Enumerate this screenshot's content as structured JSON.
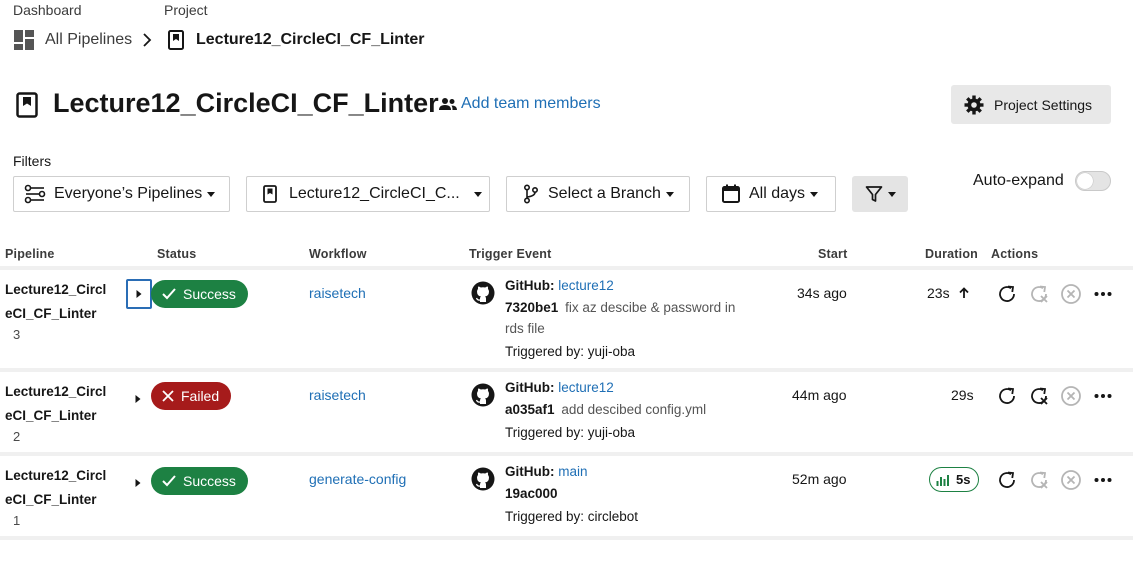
{
  "breadcrumb": {
    "dashboard_label": "Dashboard",
    "project_label": "Project",
    "all_pipelines": "All Pipelines",
    "project_name": "Lecture12_CircleCI_CF_Linter"
  },
  "header": {
    "title": "Lecture12_CircleCI_CF_Linter",
    "add_team_members": "Add team members",
    "project_settings": "Project Settings"
  },
  "filters": {
    "label": "Filters",
    "pipelines": "Everyone’s Pipelines",
    "project": "Lecture12_CircleCI_C...",
    "branch": "Select a Branch",
    "days": "All days",
    "auto_expand": "Auto-expand",
    "auto_expand_on": false
  },
  "table": {
    "headers": {
      "pipeline": "Pipeline",
      "status": "Status",
      "workflow": "Workflow",
      "trigger": "Trigger Event",
      "start": "Start",
      "duration": "Duration",
      "actions": "Actions"
    },
    "rows": [
      {
        "name_line1": "Lecture12_Circl",
        "name_line2": "eCI_CF_Linter",
        "number": "3",
        "status": "Success",
        "workflow": "raisetech",
        "github": "GitHub:",
        "branch": "lecture12",
        "commit_hash": "7320be1",
        "commit_msg_line1": "fix az descibe & password in",
        "commit_msg_line2": "rds file",
        "triggered_by": "Triggered by: yuji-oba",
        "start": "34s ago",
        "duration": "23s"
      },
      {
        "name_line1": "Lecture12_Circl",
        "name_line2": "eCI_CF_Linter",
        "number": "2",
        "status": "Failed",
        "workflow": "raisetech",
        "github": "GitHub:",
        "branch": "lecture12",
        "commit_hash": "a035af1",
        "commit_msg_line1": "add descibed config.yml",
        "triggered_by": "Triggered by: yuji-oba",
        "start": "44m ago",
        "duration": "29s"
      },
      {
        "name_line1": "Lecture12_Circl",
        "name_line2": "eCI_CF_Linter",
        "number": "1",
        "status": "Success",
        "workflow": "generate-config",
        "github": "GitHub:",
        "branch": "main",
        "commit_hash": "19ac000",
        "triggered_by": "Triggered by: circlebot",
        "start": "52m ago",
        "duration": "5s"
      }
    ]
  },
  "colors": {
    "success": "#1d8143",
    "failed": "#a61b1b",
    "link": "#1f6fb5"
  }
}
